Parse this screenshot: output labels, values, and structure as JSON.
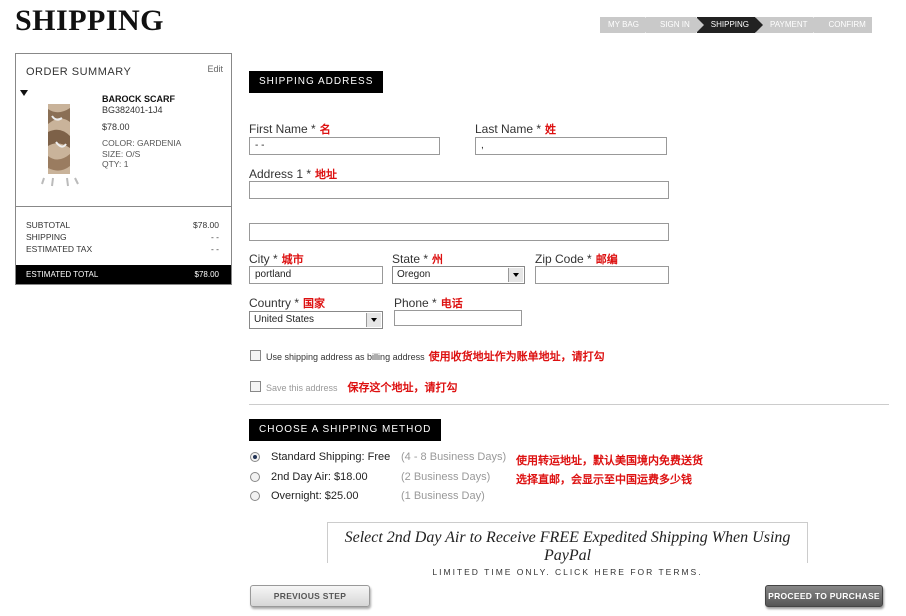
{
  "page": {
    "title": "SHIPPING"
  },
  "steps": [
    "MY BAG",
    "SIGN IN",
    "SHIPPING",
    "PAYMENT",
    "CONFIRM"
  ],
  "summary": {
    "header": "ORDER SUMMARY",
    "edit": "Edit",
    "product": {
      "name": "BAROCK SCARF",
      "sku": "BG382401-1J4",
      "price": "$78.00",
      "color": "COLOR: GARDENIA",
      "size": "SIZE: O/S",
      "qty": "QTY: 1"
    },
    "subtotal_label": "SUBTOTAL",
    "subtotal_value": "$78.00",
    "shipping_label": "SHIPPING",
    "shipping_value": "- -",
    "tax_label": "ESTIMATED TAX",
    "tax_value": "- -",
    "total_label": "ESTIMATED TOTAL",
    "total_value": "$78.00"
  },
  "shipping_address": {
    "header": "SHIPPING ADDRESS",
    "first_name": {
      "label": "First Name *",
      "cn": "名",
      "value": "- -"
    },
    "last_name": {
      "label": "Last Name *",
      "cn": "姓",
      "value": ","
    },
    "address1": {
      "label": "Address 1 *",
      "cn": "地址",
      "value": ""
    },
    "address2": {
      "value": ""
    },
    "city": {
      "label": "City *",
      "cn": "城市",
      "value": "portland"
    },
    "state": {
      "label": "State *",
      "cn": "州",
      "value": "Oregon"
    },
    "zip": {
      "label": "Zip Code *",
      "cn": "邮编",
      "value": ""
    },
    "country": {
      "label": "Country *",
      "cn": "国家",
      "value": "United States"
    },
    "phone": {
      "label": "Phone *",
      "cn": "电话",
      "value": ""
    },
    "billing_checkbox": {
      "label": "Use shipping address as billing address",
      "cn": "使用收货地址作为账单地址，请打勾"
    },
    "save_checkbox": {
      "label": "Save this address",
      "cn": "保存这个地址，请打勾"
    }
  },
  "shipping_method": {
    "header": "CHOOSE A SHIPPING METHOD",
    "options": [
      {
        "label": "Standard Shipping: Free",
        "days": "(4 - 8 Business Days)",
        "cn": "使用转运地址，默认美国境内免费送货"
      },
      {
        "label": "2nd Day Air: $18.00",
        "days": "(2 Business Days)",
        "cn": "选择直邮，会显示至中国运费多少钱"
      },
      {
        "label": "Overnight: $25.00",
        "days": "(1 Business Day)",
        "cn": ""
      }
    ],
    "selected_index": 0
  },
  "promo": {
    "headline": "Select 2nd Day Air to Receive FREE Expedited Shipping When Using PayPal",
    "sub": "LIMITED TIME ONLY. CLICK HERE FOR TERMS."
  },
  "buttons": {
    "previous": "PREVIOUS STEP",
    "proceed": "PROCEED TO PURCHASE"
  }
}
